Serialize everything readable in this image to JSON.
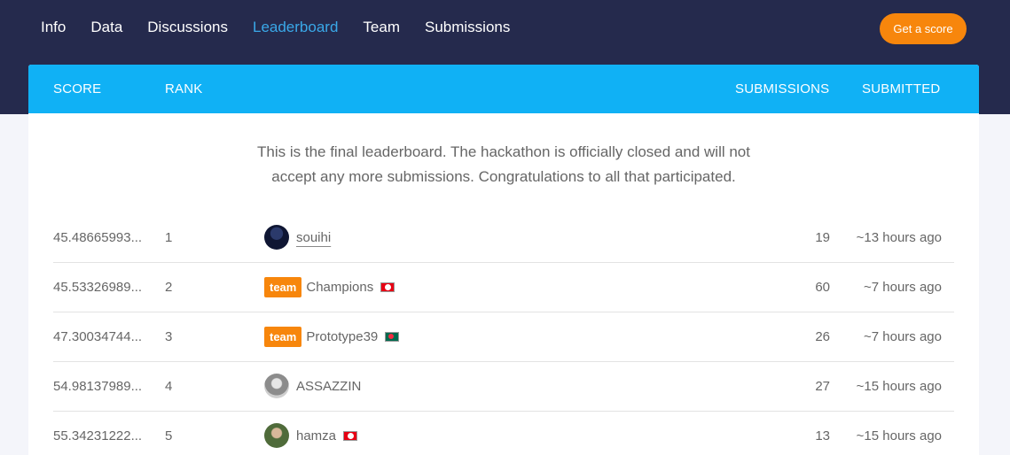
{
  "nav": {
    "items": [
      "Info",
      "Data",
      "Discussions",
      "Leaderboard",
      "Team",
      "Submissions"
    ],
    "active": "Leaderboard",
    "cta_label": "Get a score"
  },
  "table": {
    "headers": {
      "score": "SCORE",
      "rank": "RANK",
      "submissions": "SUBMISSIONS",
      "submitted": "SUBMITTED"
    },
    "notice_line1": "This is the final leaderboard. The hackathon is officially closed and will not",
    "notice_line2": "accept any more submissions. Congratulations to all that participated.",
    "rows": [
      {
        "score": "45.48665993...",
        "rank": "1",
        "name": "souihi",
        "team": "",
        "flag": "",
        "avatar": "dark-avatar",
        "submissions": "19",
        "submitted": "~13 hours ago"
      },
      {
        "score": "45.53326989...",
        "rank": "2",
        "name": "Champions",
        "team": "team",
        "flag": "tn",
        "avatar": "",
        "submissions": "60",
        "submitted": "~7 hours ago"
      },
      {
        "score": "47.30034744...",
        "rank": "3",
        "name": "Prototype39",
        "team": "team",
        "flag": "bd",
        "avatar": "",
        "submissions": "26",
        "submitted": "~7 hours ago"
      },
      {
        "score": "54.98137989...",
        "rank": "4",
        "name": "ASSAZZIN",
        "team": "",
        "flag": "",
        "avatar": "grey-avatar",
        "submissions": "27",
        "submitted": "~15 hours ago"
      },
      {
        "score": "55.34231222...",
        "rank": "5",
        "name": "hamza",
        "team": "",
        "flag": "tn",
        "avatar": "photo-avatar",
        "submissions": "13",
        "submitted": "~15 hours ago"
      }
    ]
  },
  "colors": {
    "topbar": "#252a4d",
    "header": "#10b1f5",
    "accent": "#f7860c",
    "active_link": "#3aa8e8"
  }
}
